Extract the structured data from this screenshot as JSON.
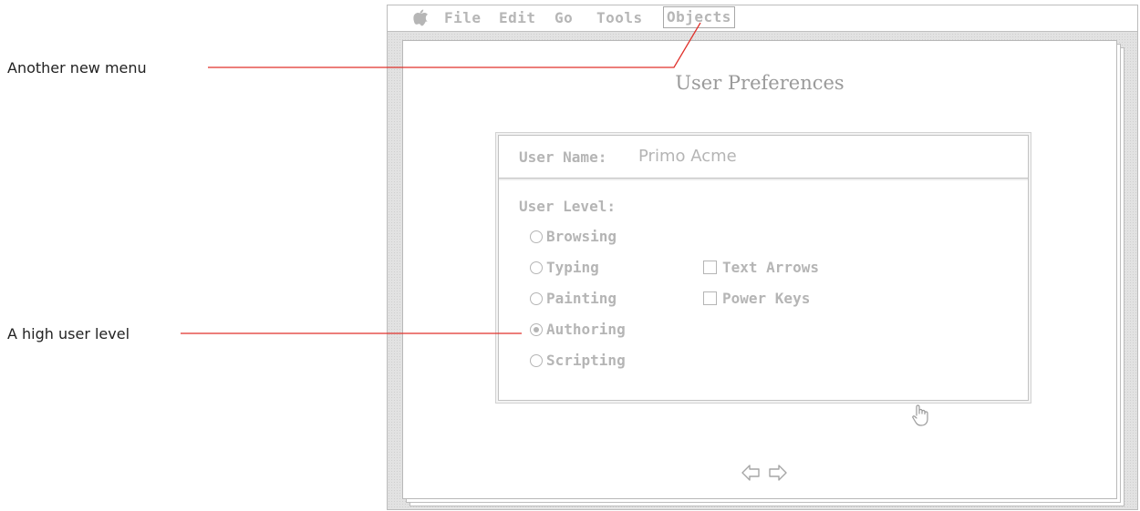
{
  "callouts": {
    "menu": "Another new menu",
    "user_level": "A high user level"
  },
  "menubar": {
    "apple": "apple-logo",
    "items": [
      "File",
      "Edit",
      "Go",
      "Tools",
      "Objects"
    ],
    "highlighted": "Objects"
  },
  "card": {
    "title": "User Preferences"
  },
  "prefs": {
    "user_name_label": "User Name:",
    "user_name_value": "Primo Acme",
    "user_level_label": "User Level:",
    "levels": [
      "Browsing",
      "Typing",
      "Painting",
      "Authoring",
      "Scripting"
    ],
    "selected_level": "Authoring",
    "options": [
      {
        "label": "Text Arrows",
        "checked": false
      },
      {
        "label": "Power Keys",
        "checked": false
      }
    ]
  },
  "colors": {
    "callout_line": "#e0312b",
    "ui_gray": "#b5b5b5"
  },
  "icons": {
    "cursor": "browse-hand-cursor",
    "prev": "left-arrow",
    "next": "right-arrow"
  }
}
